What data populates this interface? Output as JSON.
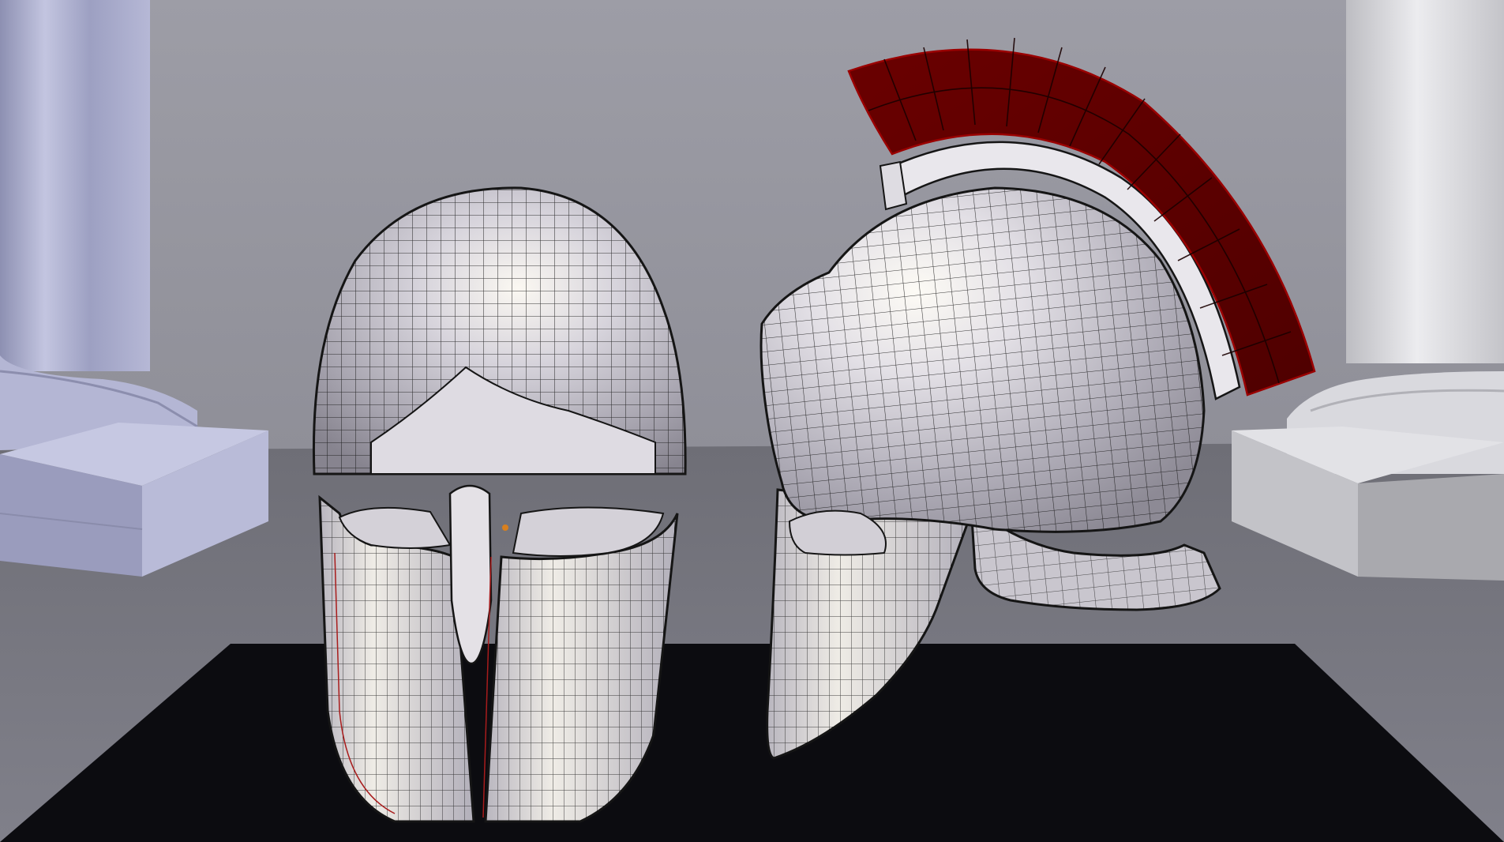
{
  "scene": {
    "kind": "3d-viewport-wireframe-render",
    "objects": [
      {
        "name": "front-helmet",
        "material": "polished-metal"
      },
      {
        "name": "side-helmet",
        "material": "polished-metal"
      },
      {
        "name": "crest",
        "material": "red"
      },
      {
        "name": "left-column",
        "material": "lavender-stone"
      },
      {
        "name": "right-column",
        "material": "white-stone"
      },
      {
        "name": "display-base",
        "material": "black"
      }
    ],
    "colors": {
      "wall": "#9a9aa2",
      "floor": "#78787f",
      "table": "#0c0c10",
      "metal_light": "#f3f0ec",
      "metal_mid": "#c9c6cf",
      "metal_dark": "#8a8792",
      "wire": "#0c0c0c",
      "crest": "#5a0000",
      "crest_edge": "#9a0000",
      "column_left": "#aeb0cf",
      "column_right": "#d8d8dc"
    }
  }
}
